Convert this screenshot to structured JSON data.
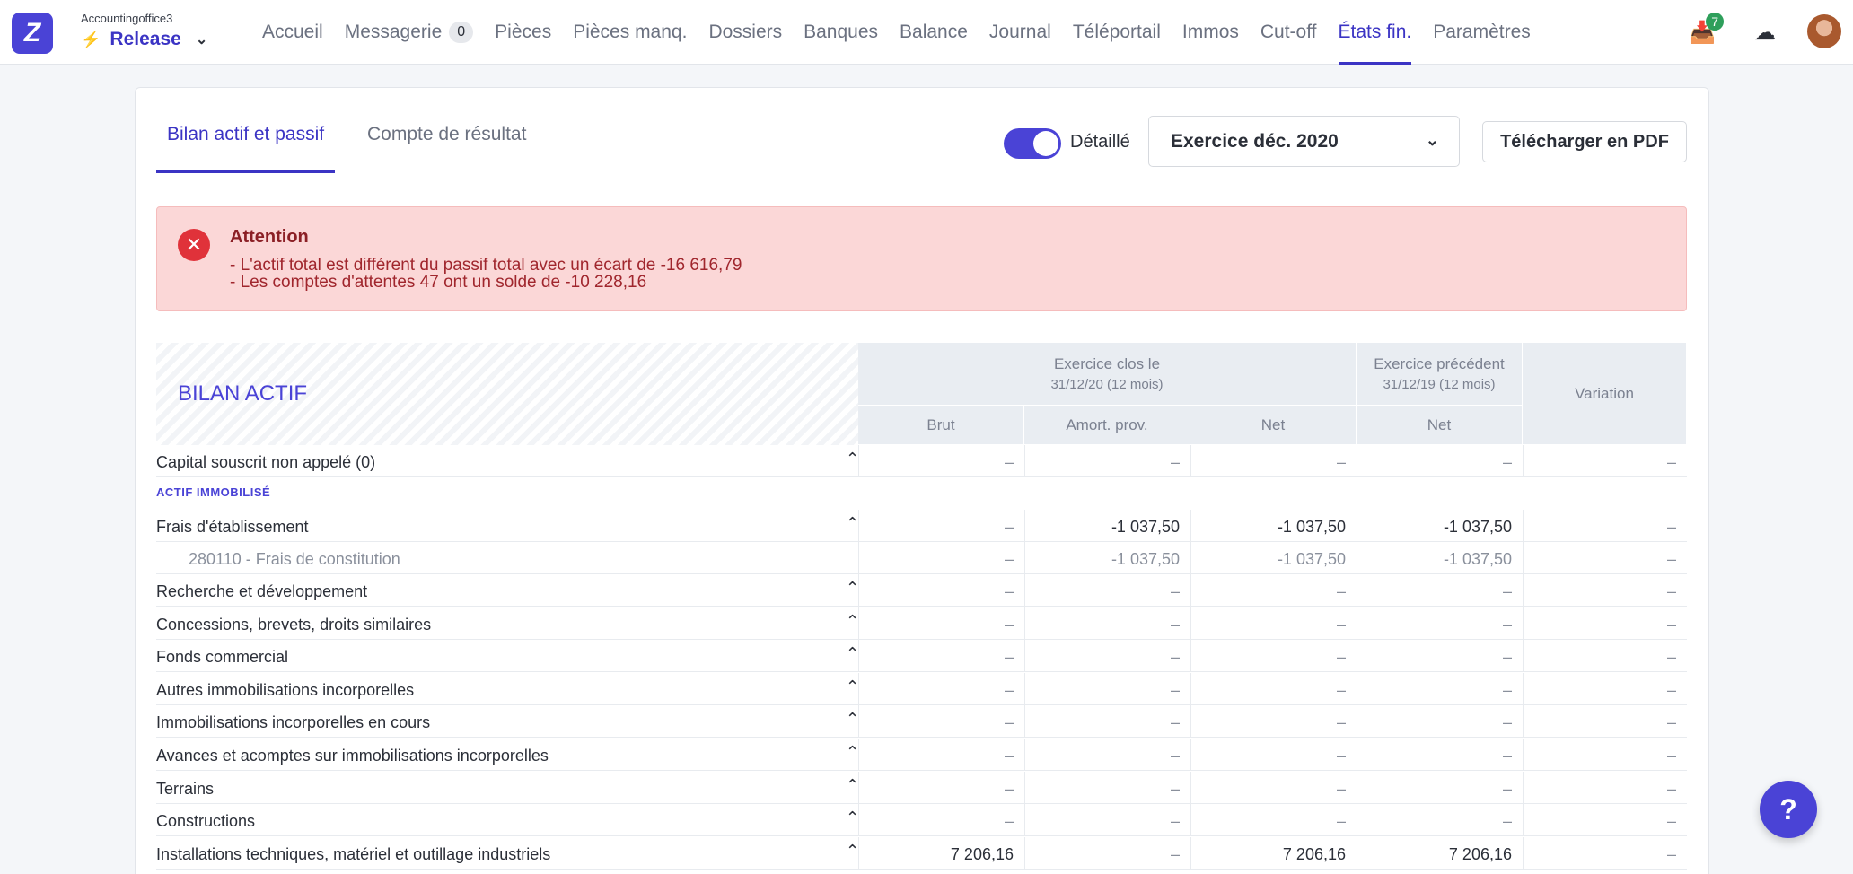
{
  "header": {
    "org": "Accountingoffice3",
    "release": "Release",
    "nav": [
      {
        "label": "Accueil"
      },
      {
        "label": "Messagerie",
        "badge": "0"
      },
      {
        "label": "Pièces"
      },
      {
        "label": "Pièces manq."
      },
      {
        "label": "Dossiers"
      },
      {
        "label": "Banques"
      },
      {
        "label": "Balance"
      },
      {
        "label": "Journal"
      },
      {
        "label": "Téléportail"
      },
      {
        "label": "Immos"
      },
      {
        "label": "Cut-off"
      },
      {
        "label": "États fin.",
        "active": true
      },
      {
        "label": "Paramètres"
      }
    ],
    "notif_count": "7"
  },
  "tabs": {
    "balance": "Bilan actif et passif",
    "result": "Compte de résultat"
  },
  "toolbar": {
    "toggle_label": "Détaillé",
    "exercise": "Exercice déc. 2020",
    "pdf_button": "Télécharger en PDF"
  },
  "alert": {
    "title": "Attention",
    "line1": "- L'actif total est différent du passif total avec un écart de -16 616,79",
    "line2": "- Les comptes d'attentes 47 ont un solde de -10 228,16"
  },
  "table": {
    "title": "BILAN ACTIF",
    "group1_title": "Exercice clos le",
    "group1_sub": "31/12/20 (12 mois)",
    "group2_title": "Exercice précédent",
    "group2_sub": "31/12/19 (12 mois)",
    "variation": "Variation",
    "col_brut": "Brut",
    "col_amort": "Amort. prov.",
    "col_net": "Net",
    "col_net_prev": "Net",
    "section_immo": "ACTIF IMMOBILISÉ",
    "rows": [
      {
        "label": "Capital souscrit non appelé (0)",
        "brut": "–",
        "amort": "–",
        "net": "–",
        "net_prev": "–",
        "var": "–"
      },
      {
        "label": "Frais d'établissement",
        "brut": "–",
        "amort": "-1 037,50",
        "net": "-1 037,50",
        "net_prev": "-1 037,50",
        "var": "–"
      },
      {
        "label": "280110 - Frais de constitution",
        "brut": "–",
        "amort": "-1 037,50",
        "net": "-1 037,50",
        "net_prev": "-1 037,50",
        "var": "–"
      },
      {
        "label": "Recherche et développement",
        "brut": "–",
        "amort": "–",
        "net": "–",
        "net_prev": "–",
        "var": "–"
      },
      {
        "label": "Concessions, brevets, droits similaires",
        "brut": "–",
        "amort": "–",
        "net": "–",
        "net_prev": "–",
        "var": "–"
      },
      {
        "label": "Fonds commercial",
        "brut": "–",
        "amort": "–",
        "net": "–",
        "net_prev": "–",
        "var": "–"
      },
      {
        "label": "Autres immobilisations incorporelles",
        "brut": "–",
        "amort": "–",
        "net": "–",
        "net_prev": "–",
        "var": "–"
      },
      {
        "label": "Immobilisations incorporelles en cours",
        "brut": "–",
        "amort": "–",
        "net": "–",
        "net_prev": "–",
        "var": "–"
      },
      {
        "label": "Avances et acomptes sur immobilisations incorporelles",
        "brut": "–",
        "amort": "–",
        "net": "–",
        "net_prev": "–",
        "var": "–"
      },
      {
        "label": "Terrains",
        "brut": "–",
        "amort": "–",
        "net": "–",
        "net_prev": "–",
        "var": "–"
      },
      {
        "label": "Constructions",
        "brut": "–",
        "amort": "–",
        "net": "–",
        "net_prev": "–",
        "var": "–"
      },
      {
        "label": "Installations techniques, matériel et outillage industriels",
        "brut": "7 206,16",
        "amort": "–",
        "net": "7 206,16",
        "net_prev": "7 206,16",
        "var": "–"
      }
    ]
  },
  "help": "?"
}
